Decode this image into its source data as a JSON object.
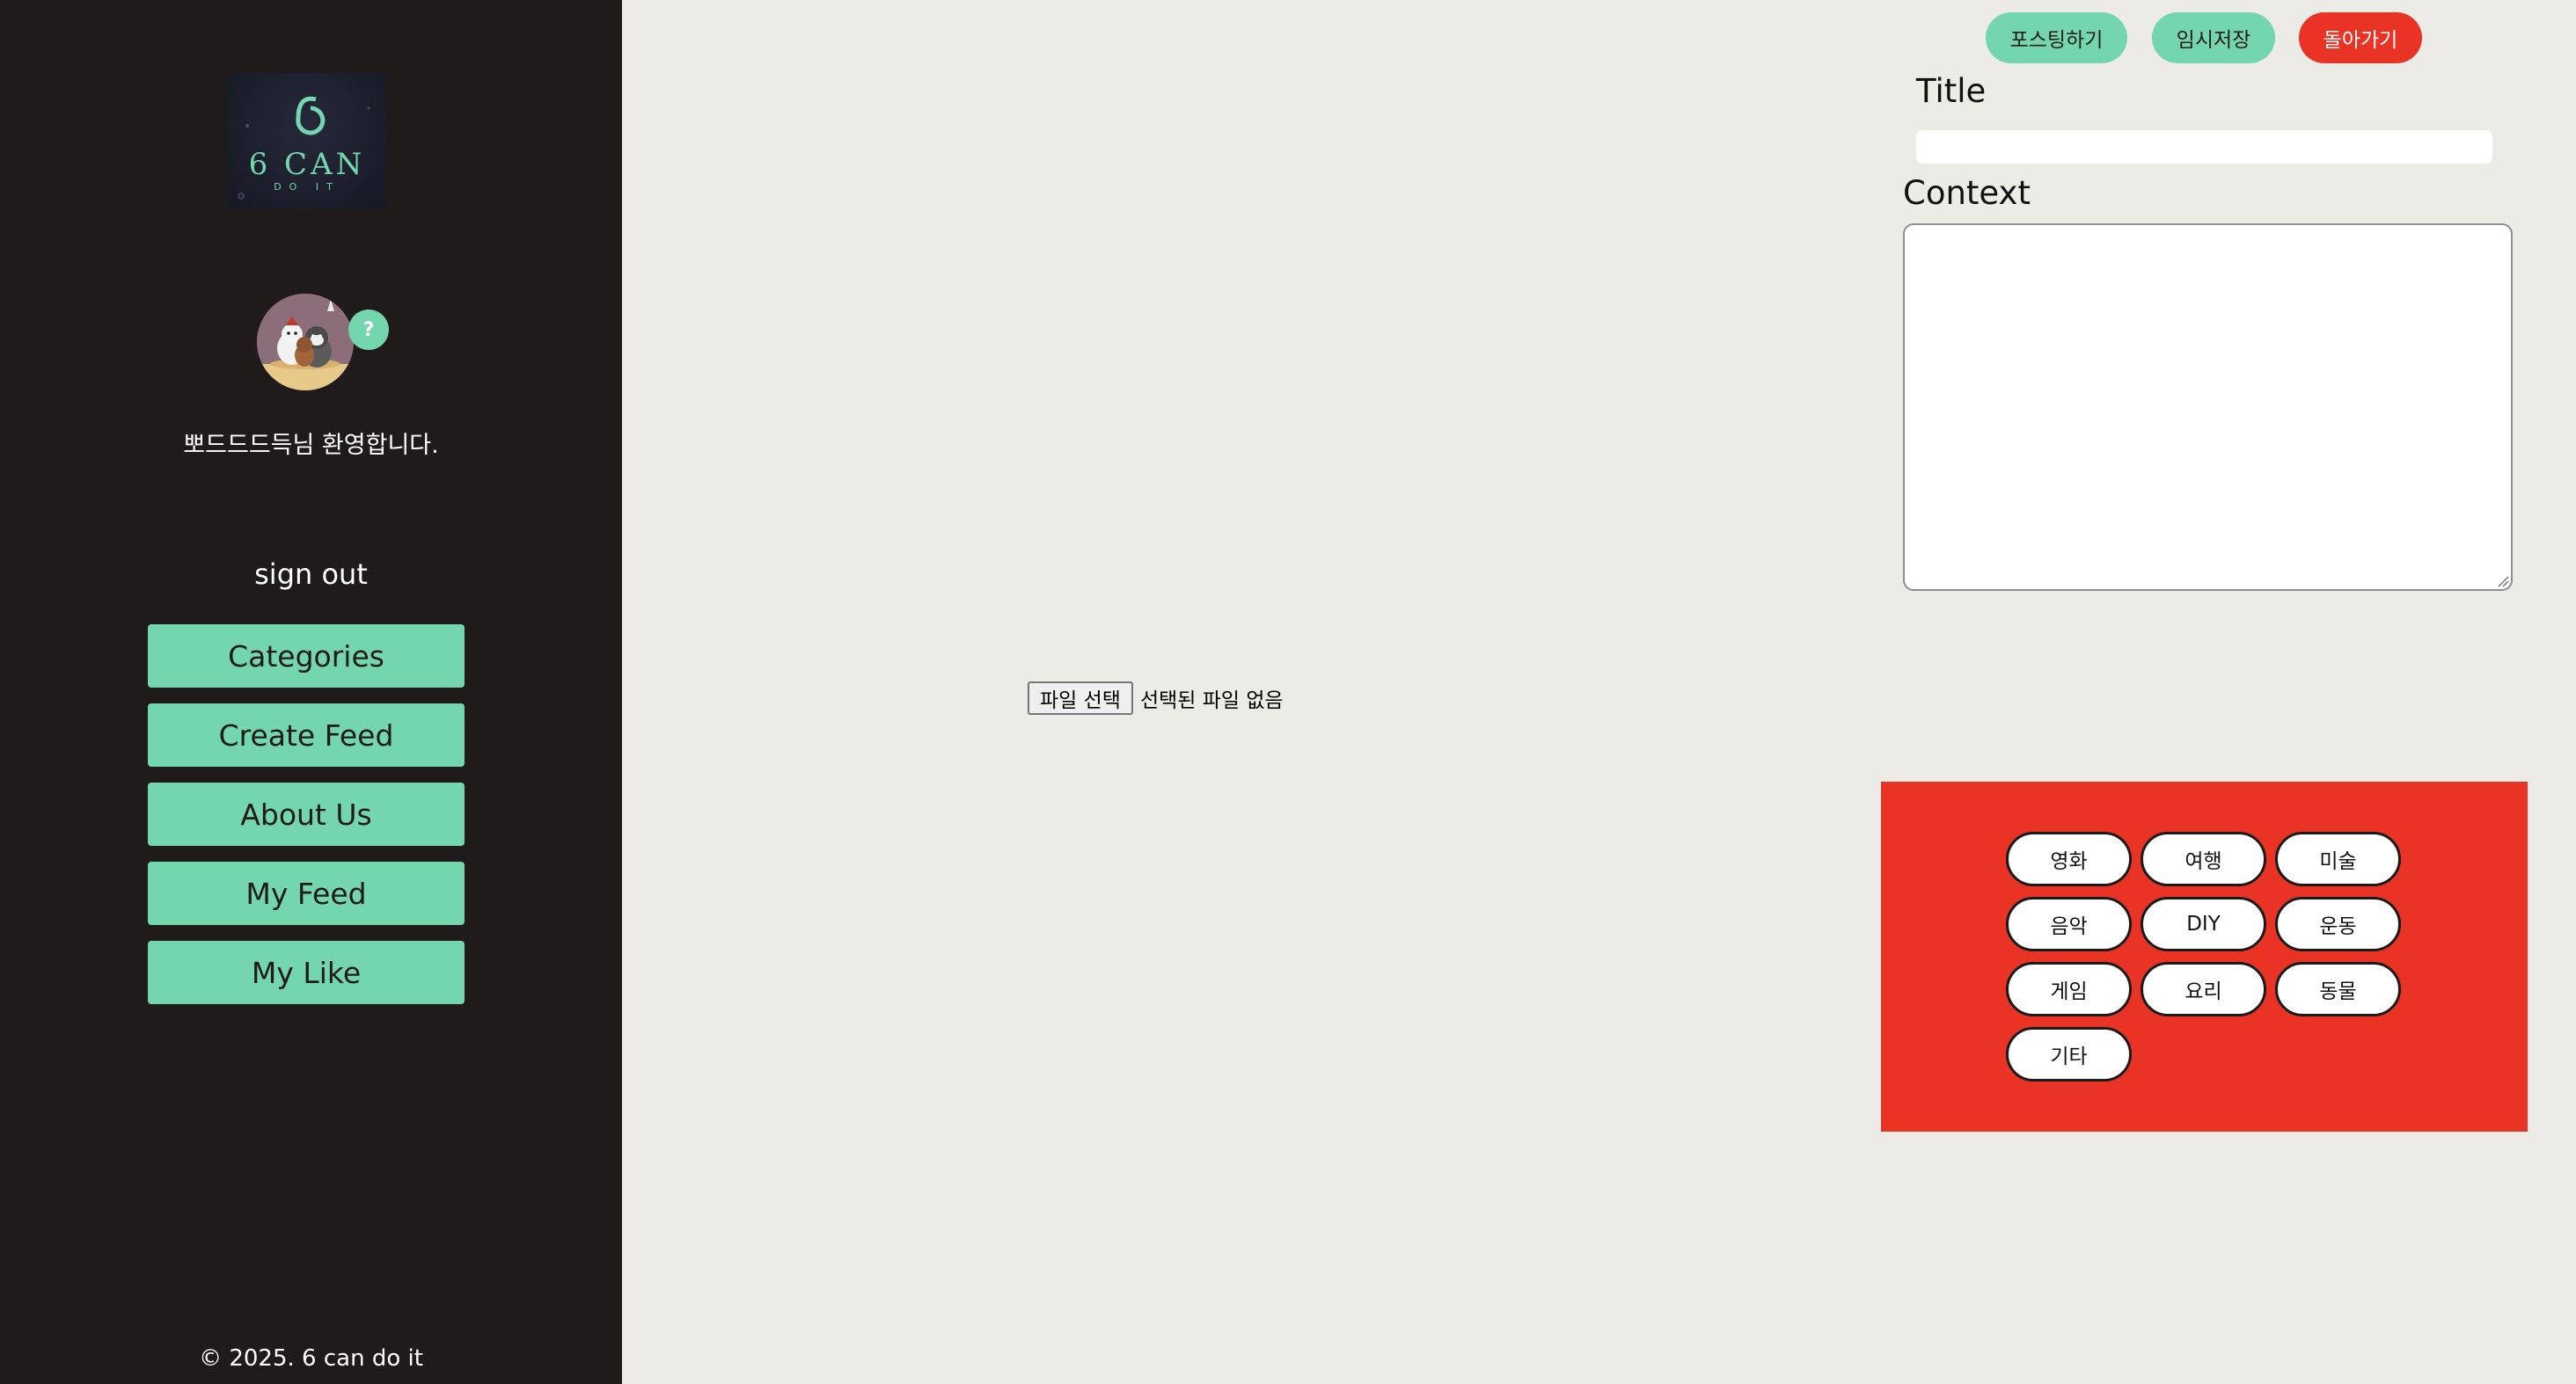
{
  "sidebar": {
    "logo_text": "6 CAN",
    "logo_subtext": "DO IT",
    "help_badge": "?",
    "welcome": "뽀드드드득님 환영합니다.",
    "sign_out": "sign out",
    "nav": {
      "categories": "Categories",
      "create_feed": "Create Feed",
      "about_us": "About Us",
      "my_feed": "My Feed",
      "my_like": "My Like"
    },
    "footer": "© 2025. 6 can do it"
  },
  "actions": {
    "post": "포스팅하기",
    "draft": "임시저장",
    "back": "돌아가기"
  },
  "form": {
    "title_label": "Title",
    "title_value": "",
    "context_label": "Context",
    "context_value": ""
  },
  "file": {
    "button": "파일 선택",
    "status": "선택된 파일 없음"
  },
  "categories": {
    "movie": "영화",
    "travel": "여행",
    "art": "미술",
    "music": "음악",
    "diy": "DIY",
    "exercise": "운동",
    "game": "게임",
    "cooking": "요리",
    "animal": "동물",
    "etc": "기타"
  },
  "colors": {
    "sidebar_bg": "#1f1b1b",
    "accent_mint": "#74d6ae",
    "accent_red": "#e83325",
    "page_bg": "#edebe6"
  }
}
